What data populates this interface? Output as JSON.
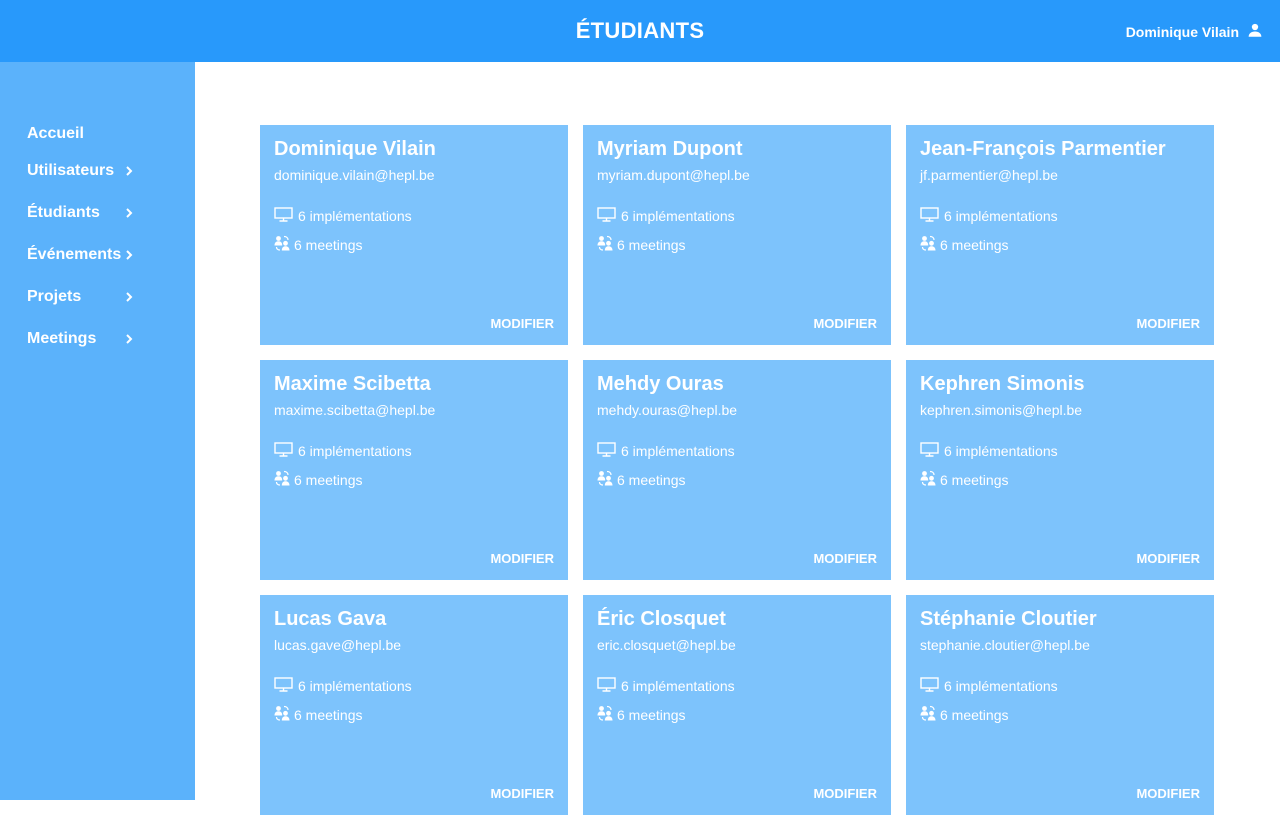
{
  "header": {
    "title": "ÉTUDIANTS",
    "user_name": "Dominique Vilain"
  },
  "sidebar": {
    "items": [
      {
        "label": "Accueil",
        "has_chevron": false
      },
      {
        "label": "Utilisateurs",
        "has_chevron": true
      },
      {
        "label": "Étudiants",
        "has_chevron": true
      },
      {
        "label": "Événements",
        "has_chevron": true
      },
      {
        "label": "Projets",
        "has_chevron": true
      },
      {
        "label": "Meetings",
        "has_chevron": true
      }
    ]
  },
  "students": [
    {
      "name": "Dominique Vilain",
      "email": "dominique.vilain@hepl.be",
      "implementations": "6 implémentations",
      "meetings": "6 meetings",
      "action": "MODIFIER"
    },
    {
      "name": "Myriam Dupont",
      "email": "myriam.dupont@hepl.be",
      "implementations": "6 implémentations",
      "meetings": "6 meetings",
      "action": "MODIFIER"
    },
    {
      "name": "Jean-François Parmentier",
      "email": "jf.parmentier@hepl.be",
      "implementations": "6 implémentations",
      "meetings": "6 meetings",
      "action": "MODIFIER"
    },
    {
      "name": "Maxime Scibetta",
      "email": "maxime.scibetta@hepl.be",
      "implementations": "6 implémentations",
      "meetings": "6 meetings",
      "action": "MODIFIER"
    },
    {
      "name": "Mehdy Ouras",
      "email": "mehdy.ouras@hepl.be",
      "implementations": "6 implémentations",
      "meetings": "6 meetings",
      "action": "MODIFIER"
    },
    {
      "name": "Kephren Simonis",
      "email": "kephren.simonis@hepl.be",
      "implementations": "6 implémentations",
      "meetings": "6 meetings",
      "action": "MODIFIER"
    },
    {
      "name": "Lucas Gava",
      "email": "lucas.gave@hepl.be",
      "implementations": "6 implémentations",
      "meetings": "6 meetings",
      "action": "MODIFIER"
    },
    {
      "name": "Éric Closquet",
      "email": "eric.closquet@hepl.be",
      "implementations": "6 implémentations",
      "meetings": "6 meetings",
      "action": "MODIFIER"
    },
    {
      "name": "Stéphanie Cloutier",
      "email": "stephanie.cloutier@hepl.be",
      "implementations": "6 implémentations",
      "meetings": "6 meetings",
      "action": "MODIFIER"
    }
  ],
  "colors": {
    "header": "#2899fb",
    "sidebar": "#5bb2fb",
    "card": "#7dc3fc"
  }
}
